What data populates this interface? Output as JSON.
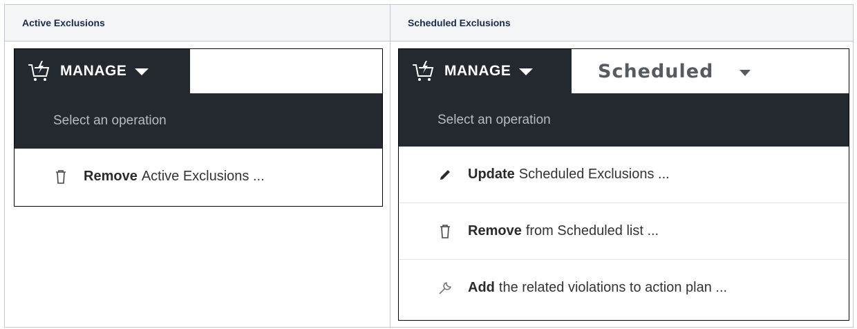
{
  "columns": [
    "Active Exclusions",
    "Scheduled Exclusions"
  ],
  "active_panel": {
    "manage_label": "MANAGE",
    "bar_text": "Select an operation",
    "items": [
      {
        "icon": "trash-icon",
        "verb": "Remove",
        "rest": "Active Exclusions ..."
      }
    ]
  },
  "scheduled_panel": {
    "manage_label": "MANAGE",
    "second_tab_label": "Scheduled",
    "bar_text": "Select an operation",
    "items": [
      {
        "icon": "pencil-icon",
        "verb": "Update",
        "rest": "Scheduled Exclusions ..."
      },
      {
        "icon": "trash-icon",
        "verb": "Remove",
        "rest": "from Scheduled list ..."
      },
      {
        "icon": "wrench-icon",
        "verb": "Add",
        "rest": "the related violations to action plan ..."
      }
    ]
  },
  "colors": {
    "dark_bar": "#23292e",
    "header_bg": "#f4f5f7",
    "border": "#c1c7d0"
  }
}
